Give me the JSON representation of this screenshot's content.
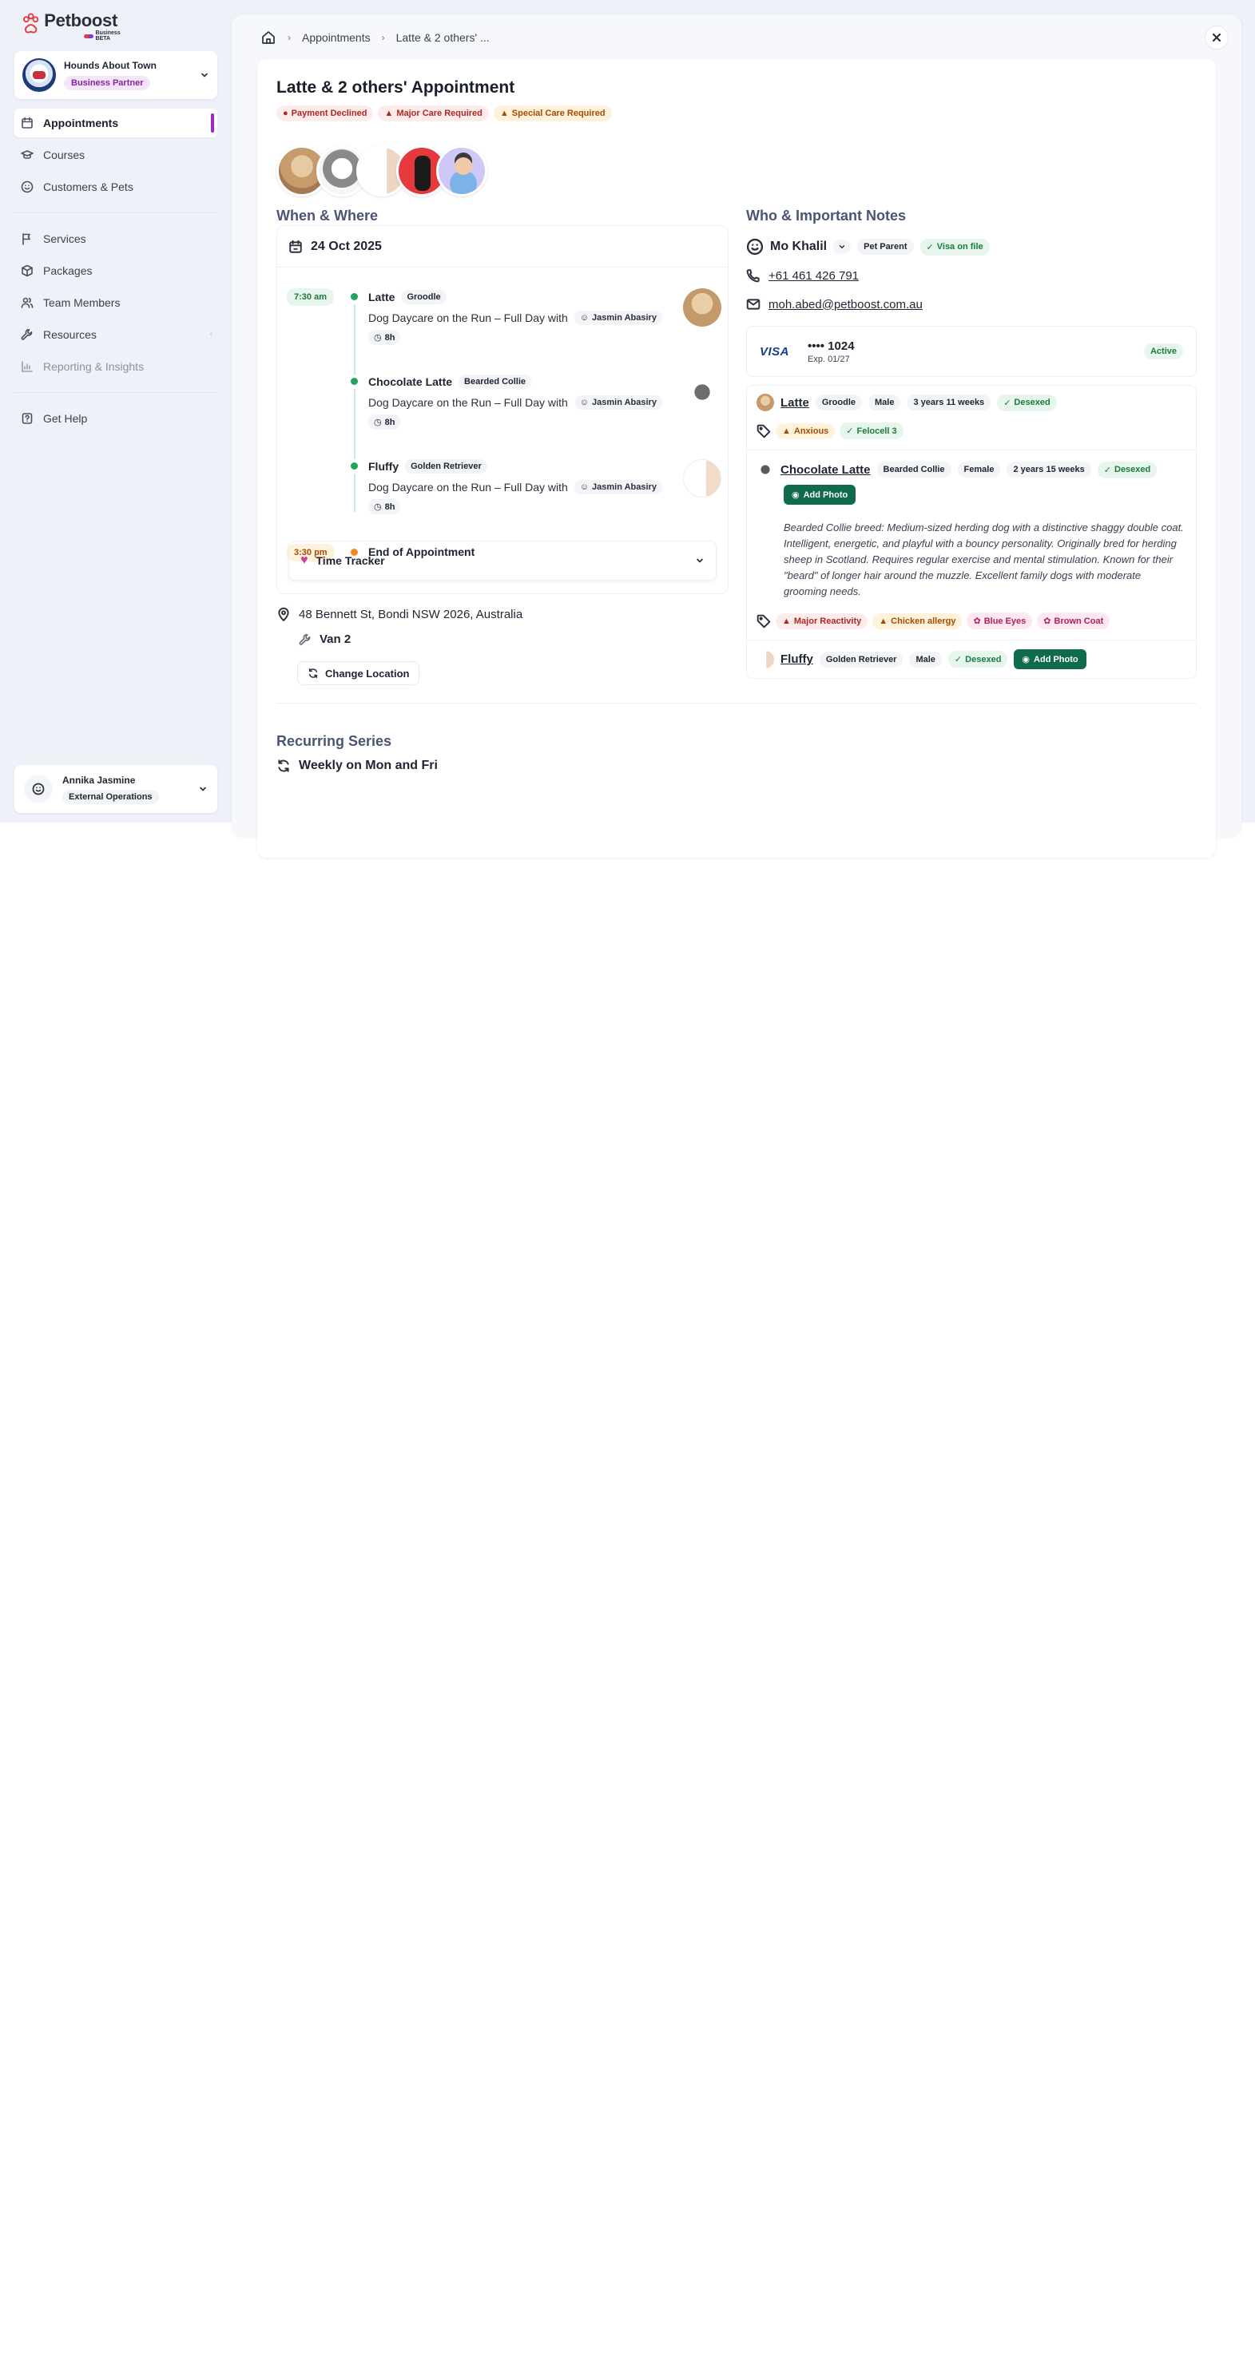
{
  "brand": {
    "name": "Petboost",
    "sub": "Business BETA"
  },
  "business": {
    "name": "Hounds About Town",
    "tier": "Business Partner"
  },
  "nav": {
    "primary": [
      {
        "label": "Appointments",
        "icon": "calendar-icon",
        "active": true
      },
      {
        "label": "Courses",
        "icon": "graduation-cap-icon"
      },
      {
        "label": "Customers & Pets",
        "icon": "smiley-icon"
      }
    ],
    "secondary": [
      {
        "label": "Services",
        "icon": "flag-icon"
      },
      {
        "label": "Packages",
        "icon": "package-icon"
      },
      {
        "label": "Team Members",
        "icon": "users-icon"
      },
      {
        "label": "Resources",
        "icon": "wrench-icon"
      },
      {
        "label": "Reporting & Insights",
        "icon": "chart-icon",
        "muted": true
      }
    ],
    "help": "Get Help"
  },
  "user": {
    "name": "Annika Jasmine",
    "role": "External Operations"
  },
  "breadcrumb": {
    "section": "Appointments",
    "current": "Latte & 2 others' ..."
  },
  "appointment": {
    "title": "Latte & 2 others' Appointment",
    "badges": [
      {
        "label": "Payment Declined",
        "tone": "red",
        "icon": "●"
      },
      {
        "label": "Major Care Required",
        "tone": "red",
        "icon": "▲"
      },
      {
        "label": "Special Care Required",
        "tone": "orange",
        "icon": "▲"
      }
    ]
  },
  "when": {
    "heading": "When & Where",
    "date": "24 Oct 2025",
    "start_time": "7:30 am",
    "end_time": "3:30 pm",
    "end_label": "End of Appointment",
    "services": [
      {
        "pet": "Latte",
        "breed": "Groodle",
        "service": "Dog Daycare on the Run – Full Day with",
        "staff": "Jasmin Abasiry",
        "duration": "8h"
      },
      {
        "pet": "Chocolate Latte",
        "breed": "Bearded Collie",
        "service": "Dog Daycare on the Run – Full Day with",
        "staff": "Jasmin Abasiry",
        "duration": "8h"
      },
      {
        "pet": "Fluffy",
        "breed": "Golden Retriever",
        "service": "Dog Daycare on the Run – Full Day with",
        "staff": "Jasmin Abasiry",
        "duration": "8h"
      }
    ],
    "time_tracker": "Time Tracker",
    "address": "48 Bennett St, Bondi NSW 2026, Australia",
    "vehicle": "Van 2",
    "change_location": "Change Location"
  },
  "recurring": {
    "heading": "Recurring Series",
    "rule": "Weekly on Mon and Fri"
  },
  "who": {
    "heading": "Who & Important Notes",
    "name": "Mo Khalil",
    "role": "Pet Parent",
    "visa_badge": "Visa on file",
    "phone": "+61 461 426 791",
    "email": "moh.abed@petboost.com.au",
    "card": {
      "brand": "VISA",
      "number": "•••• 1024",
      "expiry": "Exp. 01/27",
      "status": "Active"
    }
  },
  "pets": [
    {
      "name": "Latte",
      "breed": "Groodle",
      "sex": "Male",
      "age": "3 years 11 weeks",
      "desexed": "Desexed",
      "tags": [
        {
          "label": "Anxious",
          "tone": "orange"
        },
        {
          "label": "Felocell 3",
          "tone": "green"
        }
      ]
    },
    {
      "name": "Chocolate Latte",
      "breed": "Bearded Collie",
      "sex": "Female",
      "age": "2 years 15 weeks",
      "desexed": "Desexed",
      "add_photo": "Add Photo",
      "description": "Bearded Collie breed: Medium-sized herding dog with a distinctive shaggy double coat. Intelligent, energetic, and playful with a bouncy personality. Originally bred for herding sheep in Scotland. Requires regular exercise and mental stimulation. Known for their \"beard\" of longer hair around the muzzle. Excellent family dogs with moderate grooming needs.",
      "tags": [
        {
          "label": "Major Reactivity",
          "tone": "red"
        },
        {
          "label": "Chicken allergy",
          "tone": "orange"
        },
        {
          "label": "Blue Eyes",
          "tone": "pink"
        },
        {
          "label": "Brown Coat",
          "tone": "pink"
        }
      ]
    },
    {
      "name": "Fluffy",
      "breed": "Golden Retriever",
      "sex": "Male",
      "desexed": "Desexed",
      "add_photo": "Add Photo"
    }
  ],
  "colors": {
    "accent": "#9b2bc4",
    "primary_green": "#0f6b4a",
    "danger": "#b3261e",
    "warning": "#a84a00"
  }
}
